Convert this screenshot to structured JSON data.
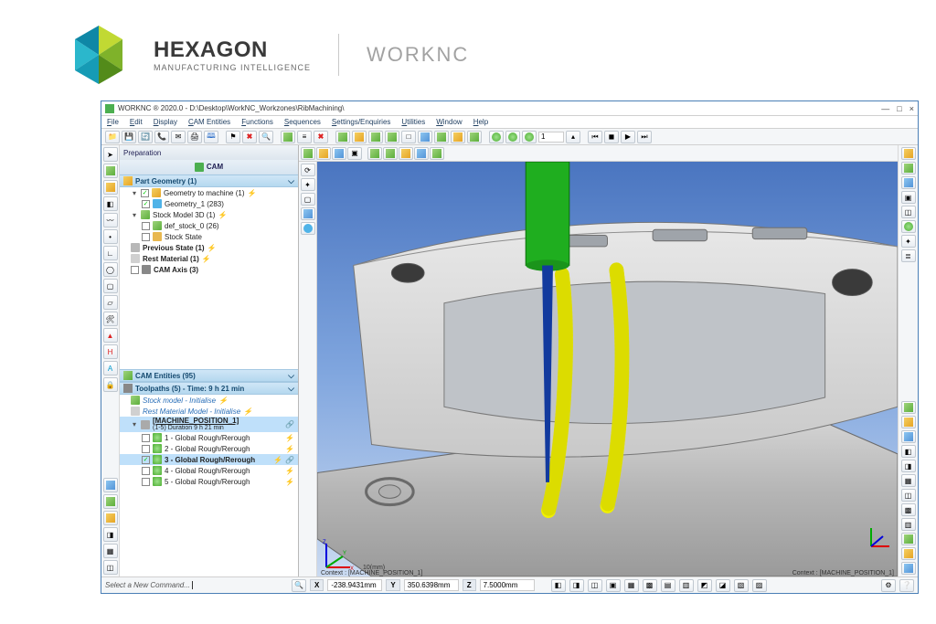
{
  "brand": {
    "title": "HEXAGON",
    "subtitle": "MANUFACTURING INTELLIGENCE",
    "product": "WORKNC"
  },
  "window": {
    "title": "WORKNC ® 2020.0 - D:\\Desktop\\WorkNC_Workzones\\RibMachining\\"
  },
  "menus": [
    "File",
    "Edit",
    "Display",
    "CAM Entities",
    "Functions",
    "Sequences",
    "Settings/Enquiries",
    "Utilities",
    "Window",
    "Help"
  ],
  "toolbar_spin": "1",
  "tree": {
    "tab_prep": "Preparation",
    "tab_cam": "CAM",
    "section_part": "Part Geometry (1)",
    "section_toolpaths": "Toolpaths (5) - Time: 9 h 21 min",
    "items": {
      "geom_to_machine": "Geometry to machine (1)",
      "geom1": "Geometry_1 (283)",
      "stock_model": "Stock Model 3D (1)",
      "def_stock": "def_stock_0 (26)",
      "stock_state": "Stock State",
      "previous_state": "Previous State (1)",
      "rest_material": "Rest Material (1)",
      "cam_axis": "CAM Axis (3)",
      "cam_entities": "CAM Entities (95)"
    },
    "tp": {
      "stock_init": "Stock model - Initialise",
      "rest_init": "Rest Material Model - Initialise",
      "machine_pos": "[MACHINE_POSITION_1]",
      "machine_pos_sub": "(1-5) Duration 9 h 21 min",
      "tp1": "1 - Global Rough/Rerough",
      "tp2": "2 - Global Rough/Rerough",
      "tp3": "3 - Global Rough/Rerough",
      "tp4": "4 - Global Rough/Rerough",
      "tp5": "5 - Global Rough/Rerough"
    }
  },
  "viewport": {
    "context_left": "Context : [MACHINE_POSITION_1]",
    "context_right": "Context : [MACHINE_POSITION_1]",
    "scale": "10(mm)"
  },
  "status": {
    "cmd_prompt": "Select a New Command...",
    "x_label": "X",
    "x_val": "-238.9431mm",
    "y_label": "Y",
    "y_val": "350.6398mm",
    "z_label": "Z",
    "z_val": "7.5000mm"
  },
  "icons": {
    "minimize": "—",
    "maximize": "□",
    "close": "×"
  }
}
